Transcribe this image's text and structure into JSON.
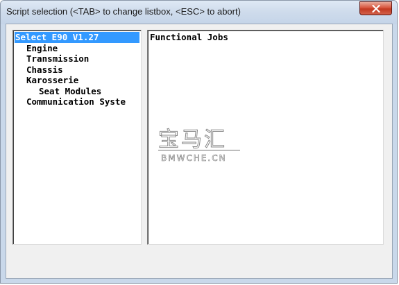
{
  "window": {
    "title": "Script selection  (<TAB> to change listbox, <ESC> to abort)",
    "close_icon": "close-icon",
    "close_color": "#c7432b"
  },
  "left_list": {
    "items": [
      {
        "label": "Select E90 V1.27",
        "selected": true
      },
      {
        "label": "Engine",
        "selected": false
      },
      {
        "label": "Transmission",
        "selected": false
      },
      {
        "label": "Chassis",
        "selected": false
      },
      {
        "label": "Karosserie",
        "selected": false
      },
      {
        "label": "Seat Modules",
        "selected": false
      },
      {
        "label": "Communication Syste",
        "selected": false
      }
    ],
    "selection_color": "#3399ff"
  },
  "right_list": {
    "items": [
      {
        "label": "Functional Jobs"
      }
    ]
  },
  "watermark": {
    "chinese": "宝马汇",
    "latin": "BMWCHE.CN"
  }
}
